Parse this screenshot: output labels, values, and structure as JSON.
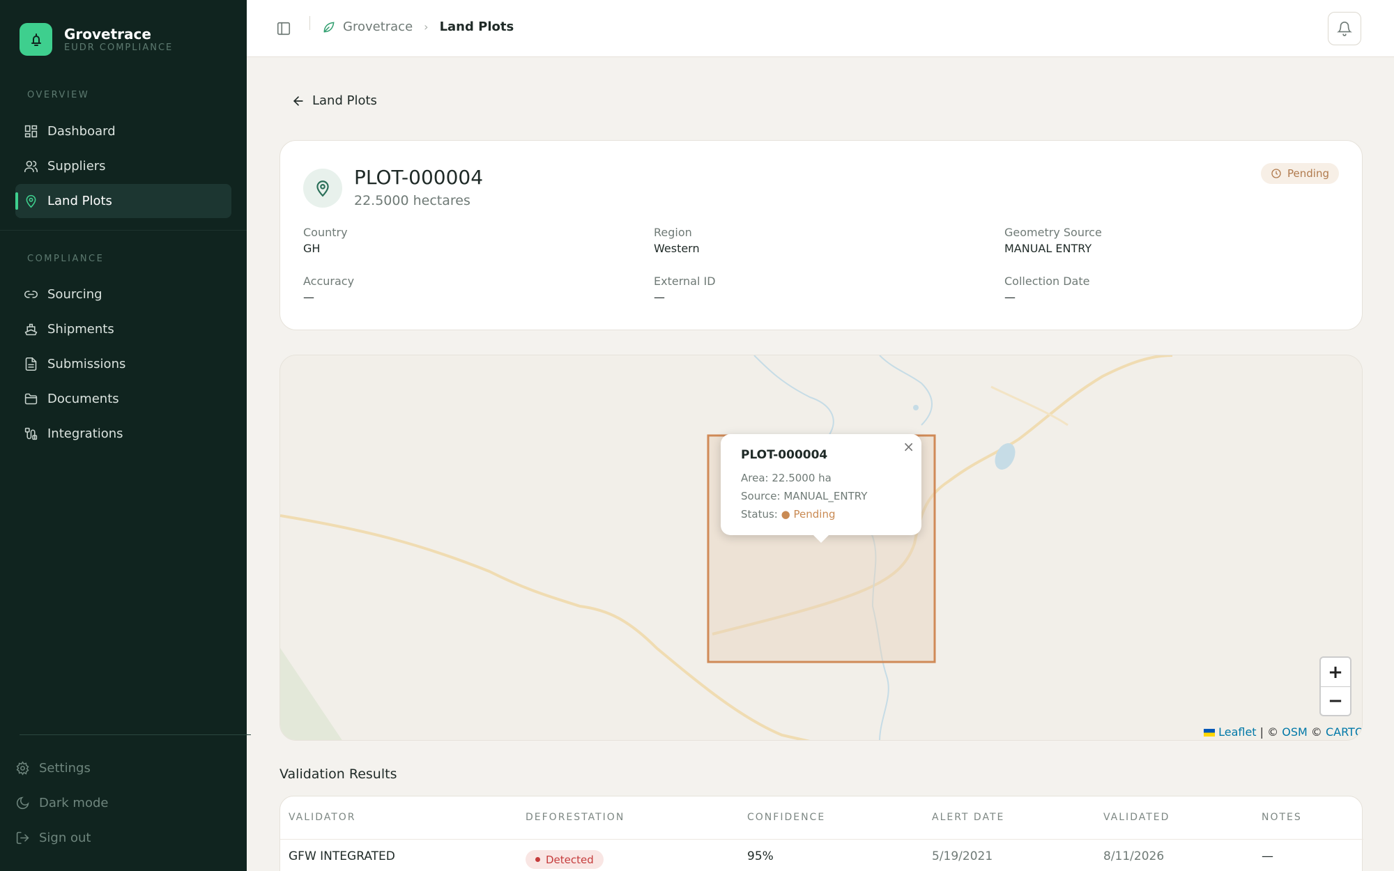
{
  "app": {
    "name": "Grovetrace",
    "subtitle": "EUDR COMPLIANCE",
    "accent_color": "#3ecf8e",
    "sidebar_bg": "#10241f"
  },
  "sidebar": {
    "overview_label": "OVERVIEW",
    "compliance_label": "COMPLIANCE",
    "overview_items": [
      {
        "label": "Dashboard",
        "icon": "dashboard-icon"
      },
      {
        "label": "Suppliers",
        "icon": "users-icon"
      },
      {
        "label": "Land Plots",
        "icon": "map-pin-icon",
        "active": true
      }
    ],
    "compliance_items": [
      {
        "label": "Sourcing",
        "icon": "link-icon"
      },
      {
        "label": "Shipments",
        "icon": "ship-icon"
      },
      {
        "label": "Submissions",
        "icon": "file-text-icon"
      },
      {
        "label": "Documents",
        "icon": "folder-icon"
      },
      {
        "label": "Integrations",
        "icon": "plug-icon"
      }
    ],
    "bottom_items": [
      {
        "label": "Settings",
        "icon": "gear-icon"
      },
      {
        "label": "Dark mode",
        "icon": "moon-icon"
      },
      {
        "label": "Sign out",
        "icon": "logout-icon"
      }
    ]
  },
  "header": {
    "breadcrumb_root": "Grovetrace",
    "breadcrumb_current": "Land Plots"
  },
  "back_link": "Land Plots",
  "plot": {
    "id": "PLOT-000004",
    "area": "22.5000 hectares",
    "status": "Pending",
    "status_color": "#b07a4d",
    "fields": {
      "country_label": "Country",
      "country": "GH",
      "region_label": "Region",
      "region": "Western",
      "geometry_label": "Geometry Source",
      "geometry": "MANUAL ENTRY",
      "accuracy_label": "Accuracy",
      "accuracy": "—",
      "external_label": "External ID",
      "external": "—",
      "collection_label": "Collection Date",
      "collection": "—"
    }
  },
  "map": {
    "popup": {
      "title": "PLOT-000004",
      "area_label": "Area:",
      "area": "22.5000 ha",
      "source_label": "Source:",
      "source": "MANUAL_ENTRY",
      "status_label": "Status:",
      "status": "Pending"
    },
    "zoom_in": "+",
    "zoom_out": "−",
    "attrib_leaflet": "Leaflet",
    "attrib_sep": " | © ",
    "attrib_osm": "OSM",
    "attrib_sep2": " © ",
    "attrib_carto": "CARTO"
  },
  "validation": {
    "title": "Validation Results",
    "columns": [
      "VALIDATOR",
      "DEFORESTATION",
      "CONFIDENCE",
      "ALERT DATE",
      "VALIDATED",
      "NOTES"
    ],
    "rows": [
      {
        "validator": "GFW INTEGRATED",
        "deforestation": "Detected",
        "confidence": "95%",
        "alert_date": "5/19/2021",
        "validated": "8/11/2026",
        "notes": "—"
      }
    ]
  }
}
